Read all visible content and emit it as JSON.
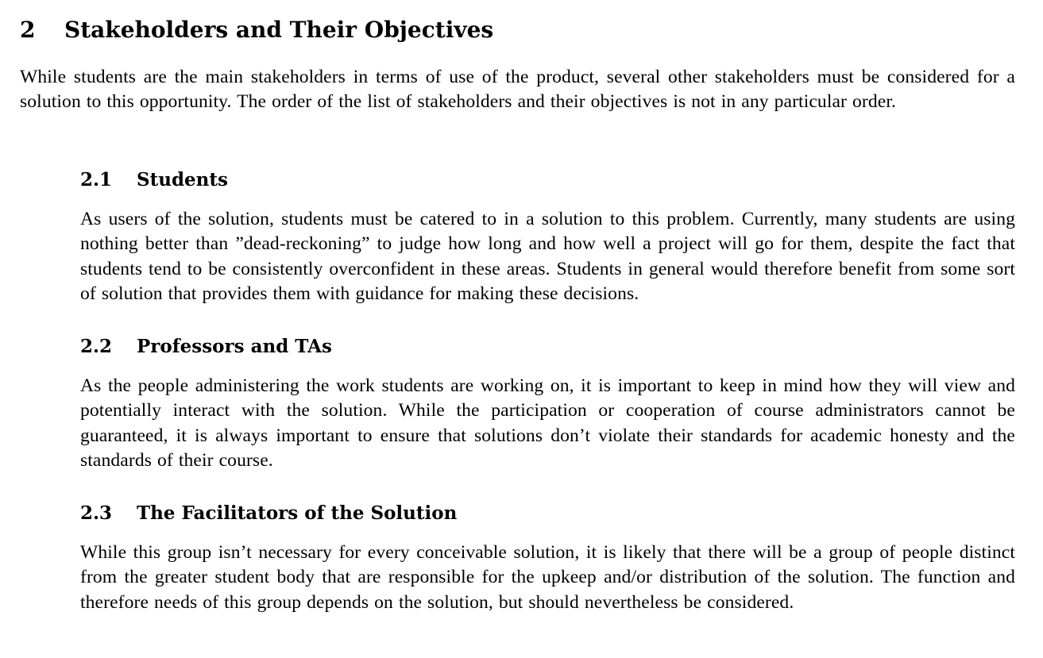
{
  "section": {
    "number": "2",
    "title": "Stakeholders and Their Objectives",
    "intro": "While students are the main stakeholders in terms of use of the product, several other stakeholders must be considered for a solution to this opportunity.  The order of the list of stakeholders and their objectives is not in any particular order."
  },
  "subsections": [
    {
      "number": "2.1",
      "title": "Students",
      "body": "As users of the solution, students must be catered to in a solution to this problem. Currently, many students are using nothing better than ”dead-reckoning” to judge how long and how well a project will go for them, despite the fact that students tend to be consistently overconfident in these areas. Students in general would therefore benefit from some sort of solution that provides them with guidance for making these decisions."
    },
    {
      "number": "2.2",
      "title": "Professors and TAs",
      "body": "As the people administering the work students are working on, it is important to keep in mind how they will view and potentially interact with the solution.  While the participation or cooperation of course administrators cannot be guaranteed, it is always important to ensure that solutions don’t violate their standards for academic honesty and the standards of their course."
    },
    {
      "number": "2.3",
      "title": "The Facilitators of the Solution",
      "body": "While this group isn’t necessary for every conceivable solution, it is likely that there will be a group of people distinct from the greater student body that are responsible for the upkeep and/or distribution of the solution. The function and therefore needs of this group depends on the solution, but should nevertheless be considered."
    }
  ]
}
